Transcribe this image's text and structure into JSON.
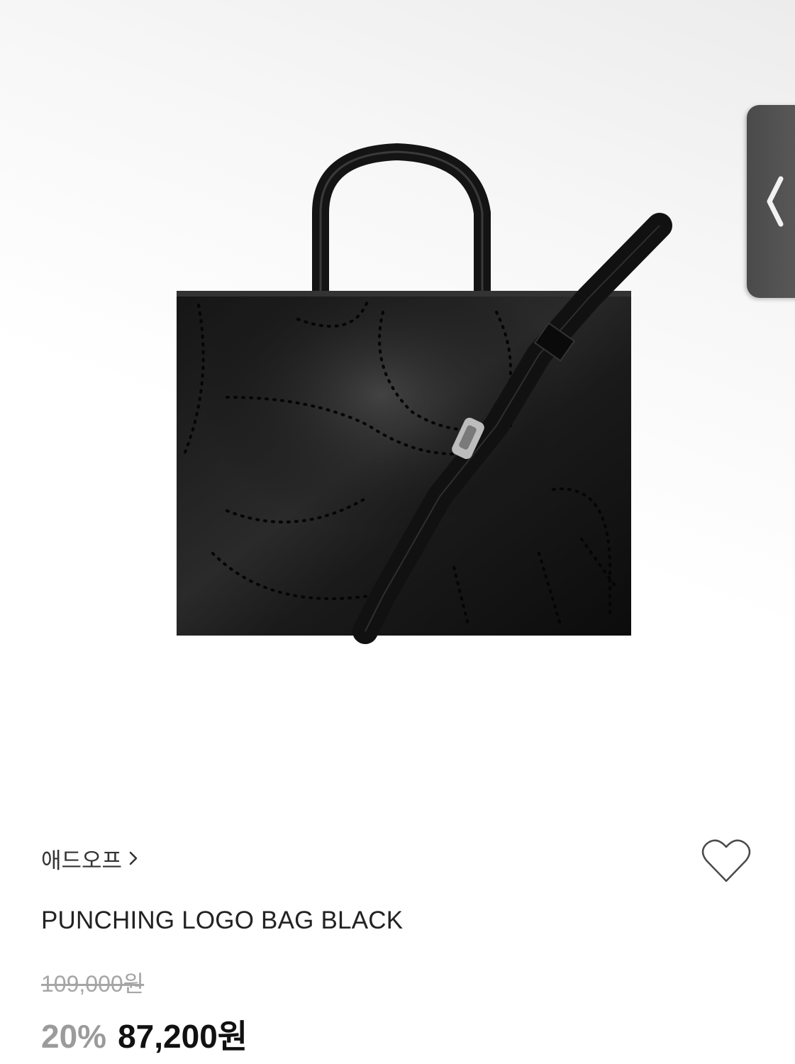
{
  "product": {
    "brand": "애드오프",
    "name": "PUNCHING LOGO BAG BLACK",
    "original_price": "109,000원",
    "discount": "20%",
    "sale_price": "87,200원"
  },
  "icons": {
    "brand_link": "chevron-right-icon",
    "wishlist": "heart-outline-icon",
    "side_tab": "chevron-left-icon"
  },
  "colors": {
    "discount": "#9b9b9b",
    "price": "#111111",
    "original_price": "#a6a6a6",
    "side_tab": "#4a4a4a"
  }
}
